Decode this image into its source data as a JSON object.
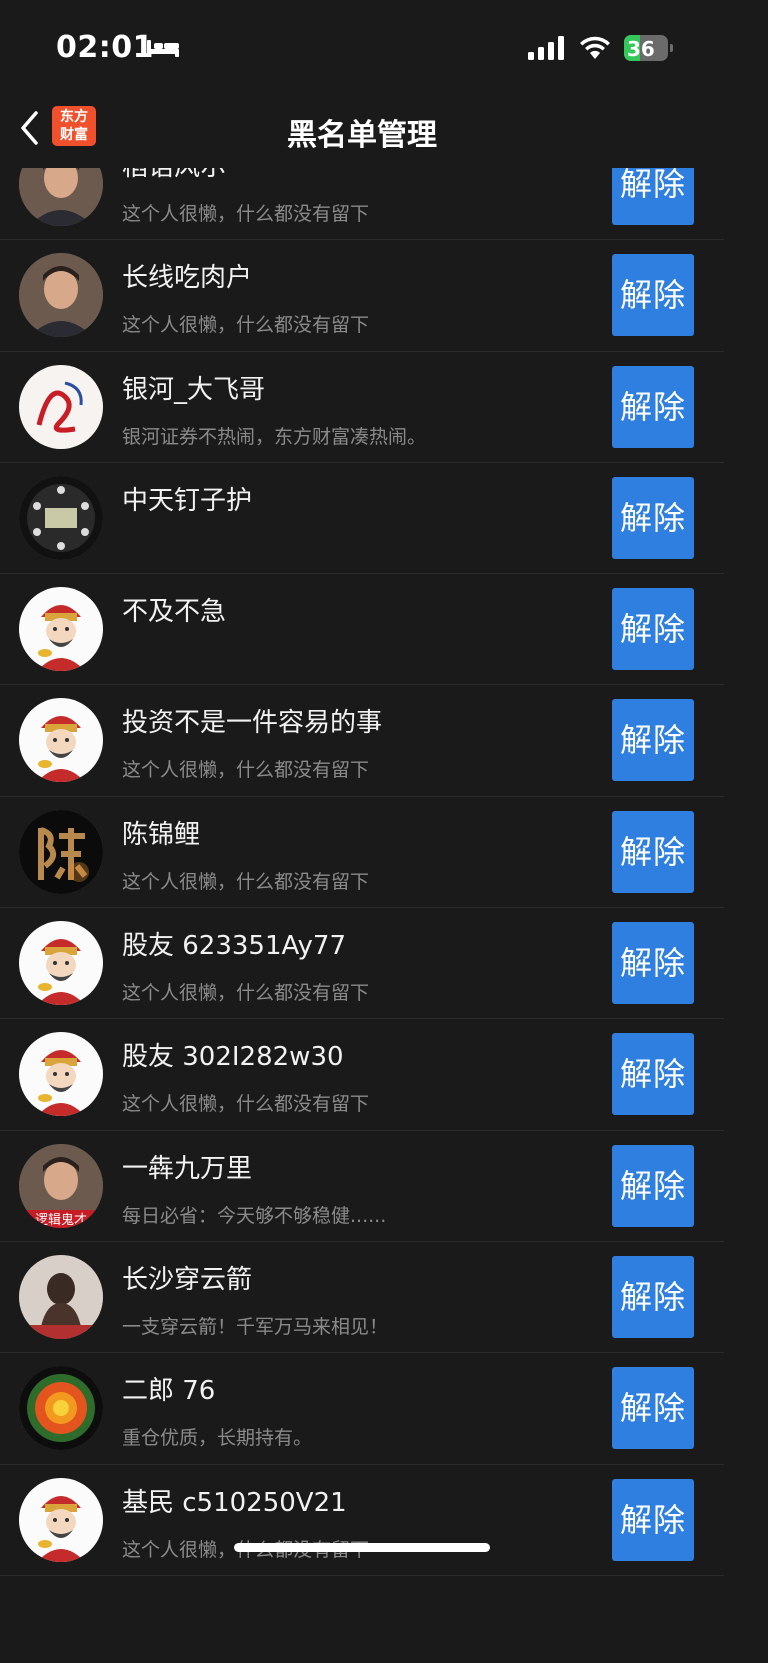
{
  "status_bar": {
    "time": "02:01",
    "battery": "36",
    "battery_level": 0.36
  },
  "nav": {
    "logo_line1": "东方",
    "logo_line2": "财富",
    "title": "黑名单管理"
  },
  "unblock_label": "解除",
  "users": [
    {
      "name": "稻语风尔",
      "signature": "这个人很懒，什么都没有留下",
      "avatar": "person-avatar"
    },
    {
      "name": "长线吃肉户",
      "signature": "这个人很懒，什么都没有留下",
      "avatar": "person-avatar"
    },
    {
      "name": "银河_大飞哥",
      "signature": "银河证券不热闹，东方财富凑热闹。",
      "avatar": "calligraphy-avatar"
    },
    {
      "name": "中天钉子护",
      "signature": "",
      "avatar": "device-avatar"
    },
    {
      "name": "不及不急",
      "signature": "",
      "avatar": "cartoon-wealth-god-avatar"
    },
    {
      "name": "投资不是一件容易的事",
      "signature": "这个人很懒，什么都没有留下",
      "avatar": "cartoon-wealth-god-avatar"
    },
    {
      "name": "陈锦鲤",
      "signature": "这个人很懒，什么都没有留下",
      "avatar": "chen-character-avatar"
    },
    {
      "name": "股友 623351Ay77",
      "signature": "这个人很懒，什么都没有留下",
      "avatar": "cartoon-wealth-god-avatar"
    },
    {
      "name": "股友 302I282w30",
      "signature": "这个人很懒，什么都没有留下",
      "avatar": "cartoon-wealth-god-avatar"
    },
    {
      "name": "一犇九万里",
      "signature": "每日必省：今天够不够稳健......",
      "avatar": "person-avatar",
      "badge": "逻辑鬼才"
    },
    {
      "name": "长沙穿云箭",
      "signature": "一支穿云箭！千军万马来相见！",
      "avatar": "statue-avatar"
    },
    {
      "name": "二郎 76",
      "signature": "重仓优质，长期持有。",
      "avatar": "flower-avatar"
    },
    {
      "name": "基民 c510250V21",
      "signature": "这个人很懒，什么都没有留下",
      "avatar": "cartoon-wealth-god-avatar"
    }
  ]
}
